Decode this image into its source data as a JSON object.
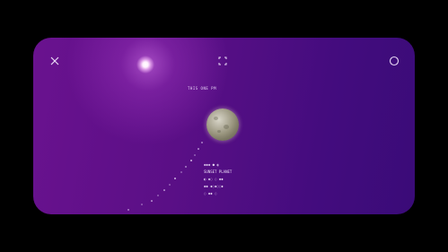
{
  "header": {
    "close_icon": "close-icon",
    "expand_icon": "expand-icon",
    "circle_icon": "circle-icon"
  },
  "overlay": {
    "top_label": "THIS ONE   PM",
    "info_lines": [
      "◆◆◆ ● ◐",
      "SUNSET PLANET",
      "◐  ◆◌  ◌ ◆◆",
      "◆◆  ◆◌◆◌◌◆",
      "◌  ◆◆  ◌"
    ]
  },
  "colors": {
    "background": "#000000",
    "screen_start": "#6a128f",
    "screen_end": "#3a0b78",
    "text": "#e9d9f5"
  }
}
